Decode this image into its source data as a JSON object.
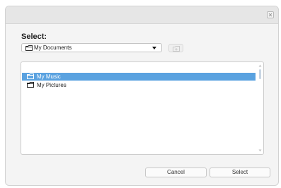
{
  "dialog": {
    "heading": "Select:",
    "location": {
      "selected": "My Documents",
      "icon": "folder-icon",
      "dropdown_icon": "triangle-down-icon"
    },
    "new_folder_icon": "new-folder-icon",
    "close_icon": "close-icon",
    "items": [
      {
        "label": "My Music",
        "selected": true,
        "icon": "folder-icon"
      },
      {
        "label": "My Pictures",
        "selected": false,
        "icon": "folder-icon"
      }
    ],
    "buttons": {
      "cancel": "Cancel",
      "select": "Select"
    }
  },
  "colors": {
    "selection": "#5aa2e0",
    "dialog_bg": "#f4f4f4",
    "titlebar_bg": "#e6e6e6"
  }
}
